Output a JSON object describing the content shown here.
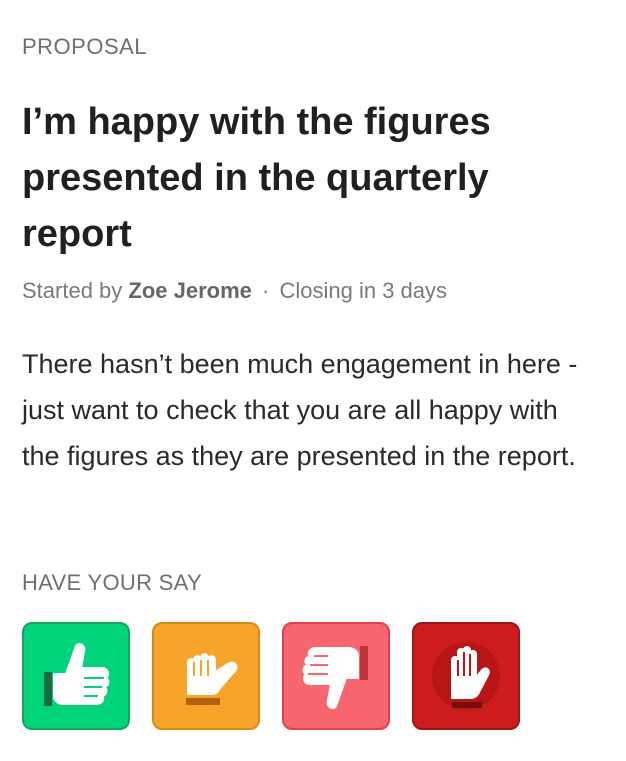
{
  "proposal": {
    "kicker": "PROPOSAL",
    "title": "I’m happy with the figures presented in the quarterly report",
    "started_by_prefix": "Started by",
    "author": "Zoe Jerome",
    "separator": "·",
    "closing": "Closing in 3 days",
    "description": "There hasn’t been much engagement in here - just want to check that you are all happy with the figures as they are presented in the report."
  },
  "have_your_say": {
    "label": "HAVE YOUR SAY",
    "options": [
      {
        "name": "agree",
        "icon": "thumbs-up-icon",
        "color": "#00d37a",
        "border": "#18a562"
      },
      {
        "name": "abstain",
        "icon": "thumb-sideways-icon",
        "color": "#f6a52a",
        "border": "#d98a16"
      },
      {
        "name": "disagree",
        "icon": "thumbs-down-icon",
        "color": "#f7666e",
        "border": "#e0414b"
      },
      {
        "name": "block",
        "icon": "stop-hand-icon",
        "color": "#cc1c1c",
        "border": "#9e1515"
      }
    ]
  }
}
